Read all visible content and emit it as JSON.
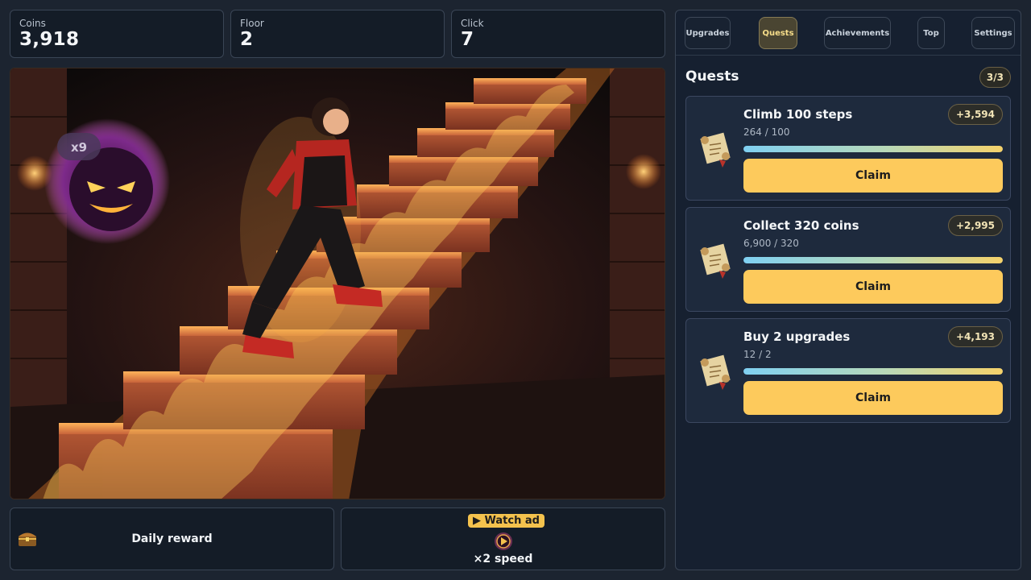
{
  "stats": {
    "coins": {
      "label": "Coins",
      "value": "3,918"
    },
    "floor": {
      "label": "Floor",
      "value": "2"
    },
    "click": {
      "label": "Click",
      "value": "7"
    }
  },
  "scene": {
    "multiplier": "x9",
    "character": "boy-climbing-stairs",
    "enemy": "flame-ghost"
  },
  "bottom": {
    "daily": {
      "label": "Daily reward",
      "icon": "treasure-chest-icon"
    },
    "ad": {
      "badge": "▶ Watch ad",
      "label": "×2 speed",
      "icon": "speed-boost-icon"
    }
  },
  "tabs": [
    {
      "label": "Upgrades",
      "active": false
    },
    {
      "label": "Quests",
      "active": true
    },
    {
      "label": "Achievements",
      "active": false
    },
    {
      "label": "Top",
      "active": false
    },
    {
      "label": "Settings",
      "active": false
    }
  ],
  "quests_panel": {
    "title": "Quests",
    "count": "3/3",
    "items": [
      {
        "title": "Climb 100 steps",
        "progress": "264 / 100",
        "reward": "+3,594",
        "fill": 1.0,
        "action": "Claim",
        "icon": "scroll-icon"
      },
      {
        "title": "Collect 320 coins",
        "progress": "6,900 / 320",
        "reward": "+2,995",
        "fill": 1.0,
        "action": "Claim",
        "icon": "scroll-icon"
      },
      {
        "title": "Buy 2 upgrades",
        "progress": "12 / 2",
        "reward": "+4,193",
        "fill": 1.0,
        "action": "Claim",
        "icon": "scroll-icon"
      }
    ]
  },
  "colors": {
    "accent": "#fdca5c",
    "panel": "#162030",
    "fire": "#f08a2a"
  }
}
